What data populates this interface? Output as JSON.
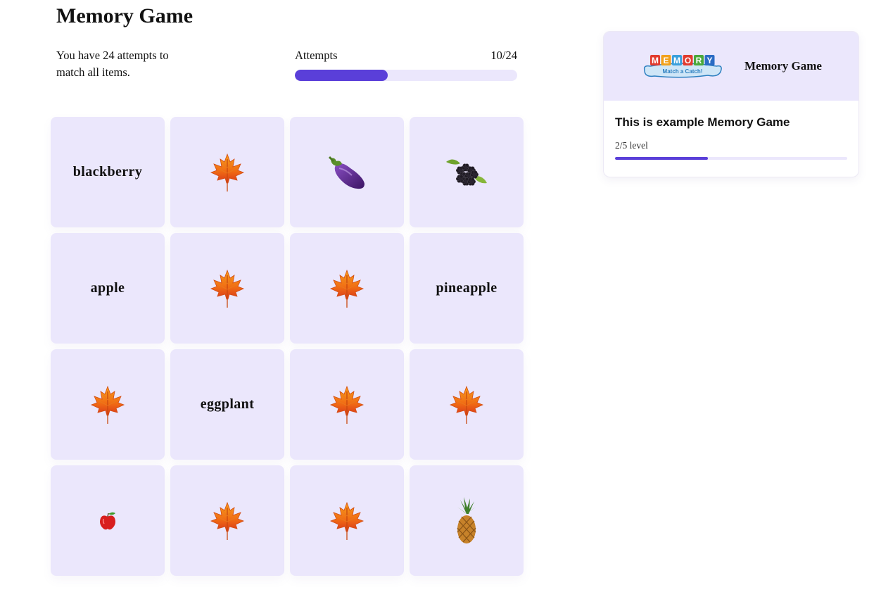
{
  "page": {
    "title": "Memory Game",
    "instructions": "You have 24 attempts to match all items."
  },
  "attempts": {
    "label": "Attempts",
    "counter": "10/24",
    "used": 10,
    "total": 24
  },
  "board": {
    "cards": [
      {
        "state": "label",
        "text": "blackberry"
      },
      {
        "state": "hidden",
        "icon": "maple-leaf-icon"
      },
      {
        "state": "image",
        "icon": "eggplant-icon"
      },
      {
        "state": "image",
        "icon": "blackberry-icon"
      },
      {
        "state": "label",
        "text": "apple"
      },
      {
        "state": "hidden",
        "icon": "maple-leaf-icon"
      },
      {
        "state": "hidden",
        "icon": "maple-leaf-icon"
      },
      {
        "state": "label",
        "text": "pineapple"
      },
      {
        "state": "hidden",
        "icon": "maple-leaf-icon"
      },
      {
        "state": "label",
        "text": "eggplant"
      },
      {
        "state": "hidden",
        "icon": "maple-leaf-icon"
      },
      {
        "state": "hidden",
        "icon": "maple-leaf-icon"
      },
      {
        "state": "image",
        "icon": "apple-icon"
      },
      {
        "state": "hidden",
        "icon": "maple-leaf-icon"
      },
      {
        "state": "hidden",
        "icon": "maple-leaf-icon"
      },
      {
        "state": "image",
        "icon": "pineapple-icon"
      }
    ]
  },
  "info": {
    "header_title": "Memory Game",
    "logo_word": "MEMORY",
    "logo_tagline": "Match a Catch!",
    "subtitle": "This is example Memory Game",
    "level_text": "2/5 level",
    "level_current": 2,
    "level_total": 5
  },
  "colors": {
    "accent": "#5a3fd9",
    "track": "#ebe7fc",
    "card_bg": "#ebe7fc"
  }
}
